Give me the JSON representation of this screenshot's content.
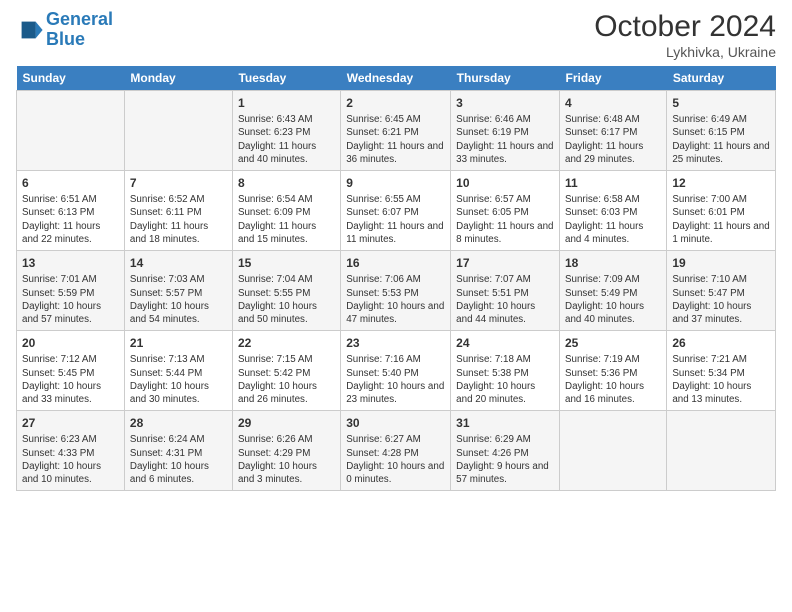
{
  "header": {
    "logo_line1": "General",
    "logo_line2": "Blue",
    "month": "October 2024",
    "location": "Lykhivka, Ukraine"
  },
  "days_of_week": [
    "Sunday",
    "Monday",
    "Tuesday",
    "Wednesday",
    "Thursday",
    "Friday",
    "Saturday"
  ],
  "weeks": [
    [
      {
        "day": "",
        "info": ""
      },
      {
        "day": "",
        "info": ""
      },
      {
        "day": "1",
        "info": "Sunrise: 6:43 AM\nSunset: 6:23 PM\nDaylight: 11 hours and 40 minutes."
      },
      {
        "day": "2",
        "info": "Sunrise: 6:45 AM\nSunset: 6:21 PM\nDaylight: 11 hours and 36 minutes."
      },
      {
        "day": "3",
        "info": "Sunrise: 6:46 AM\nSunset: 6:19 PM\nDaylight: 11 hours and 33 minutes."
      },
      {
        "day": "4",
        "info": "Sunrise: 6:48 AM\nSunset: 6:17 PM\nDaylight: 11 hours and 29 minutes."
      },
      {
        "day": "5",
        "info": "Sunrise: 6:49 AM\nSunset: 6:15 PM\nDaylight: 11 hours and 25 minutes."
      }
    ],
    [
      {
        "day": "6",
        "info": "Sunrise: 6:51 AM\nSunset: 6:13 PM\nDaylight: 11 hours and 22 minutes."
      },
      {
        "day": "7",
        "info": "Sunrise: 6:52 AM\nSunset: 6:11 PM\nDaylight: 11 hours and 18 minutes."
      },
      {
        "day": "8",
        "info": "Sunrise: 6:54 AM\nSunset: 6:09 PM\nDaylight: 11 hours and 15 minutes."
      },
      {
        "day": "9",
        "info": "Sunrise: 6:55 AM\nSunset: 6:07 PM\nDaylight: 11 hours and 11 minutes."
      },
      {
        "day": "10",
        "info": "Sunrise: 6:57 AM\nSunset: 6:05 PM\nDaylight: 11 hours and 8 minutes."
      },
      {
        "day": "11",
        "info": "Sunrise: 6:58 AM\nSunset: 6:03 PM\nDaylight: 11 hours and 4 minutes."
      },
      {
        "day": "12",
        "info": "Sunrise: 7:00 AM\nSunset: 6:01 PM\nDaylight: 11 hours and 1 minute."
      }
    ],
    [
      {
        "day": "13",
        "info": "Sunrise: 7:01 AM\nSunset: 5:59 PM\nDaylight: 10 hours and 57 minutes."
      },
      {
        "day": "14",
        "info": "Sunrise: 7:03 AM\nSunset: 5:57 PM\nDaylight: 10 hours and 54 minutes."
      },
      {
        "day": "15",
        "info": "Sunrise: 7:04 AM\nSunset: 5:55 PM\nDaylight: 10 hours and 50 minutes."
      },
      {
        "day": "16",
        "info": "Sunrise: 7:06 AM\nSunset: 5:53 PM\nDaylight: 10 hours and 47 minutes."
      },
      {
        "day": "17",
        "info": "Sunrise: 7:07 AM\nSunset: 5:51 PM\nDaylight: 10 hours and 44 minutes."
      },
      {
        "day": "18",
        "info": "Sunrise: 7:09 AM\nSunset: 5:49 PM\nDaylight: 10 hours and 40 minutes."
      },
      {
        "day": "19",
        "info": "Sunrise: 7:10 AM\nSunset: 5:47 PM\nDaylight: 10 hours and 37 minutes."
      }
    ],
    [
      {
        "day": "20",
        "info": "Sunrise: 7:12 AM\nSunset: 5:45 PM\nDaylight: 10 hours and 33 minutes."
      },
      {
        "day": "21",
        "info": "Sunrise: 7:13 AM\nSunset: 5:44 PM\nDaylight: 10 hours and 30 minutes."
      },
      {
        "day": "22",
        "info": "Sunrise: 7:15 AM\nSunset: 5:42 PM\nDaylight: 10 hours and 26 minutes."
      },
      {
        "day": "23",
        "info": "Sunrise: 7:16 AM\nSunset: 5:40 PM\nDaylight: 10 hours and 23 minutes."
      },
      {
        "day": "24",
        "info": "Sunrise: 7:18 AM\nSunset: 5:38 PM\nDaylight: 10 hours and 20 minutes."
      },
      {
        "day": "25",
        "info": "Sunrise: 7:19 AM\nSunset: 5:36 PM\nDaylight: 10 hours and 16 minutes."
      },
      {
        "day": "26",
        "info": "Sunrise: 7:21 AM\nSunset: 5:34 PM\nDaylight: 10 hours and 13 minutes."
      }
    ],
    [
      {
        "day": "27",
        "info": "Sunrise: 6:23 AM\nSunset: 4:33 PM\nDaylight: 10 hours and 10 minutes."
      },
      {
        "day": "28",
        "info": "Sunrise: 6:24 AM\nSunset: 4:31 PM\nDaylight: 10 hours and 6 minutes."
      },
      {
        "day": "29",
        "info": "Sunrise: 6:26 AM\nSunset: 4:29 PM\nDaylight: 10 hours and 3 minutes."
      },
      {
        "day": "30",
        "info": "Sunrise: 6:27 AM\nSunset: 4:28 PM\nDaylight: 10 hours and 0 minutes."
      },
      {
        "day": "31",
        "info": "Sunrise: 6:29 AM\nSunset: 4:26 PM\nDaylight: 9 hours and 57 minutes."
      },
      {
        "day": "",
        "info": ""
      },
      {
        "day": "",
        "info": ""
      }
    ]
  ]
}
